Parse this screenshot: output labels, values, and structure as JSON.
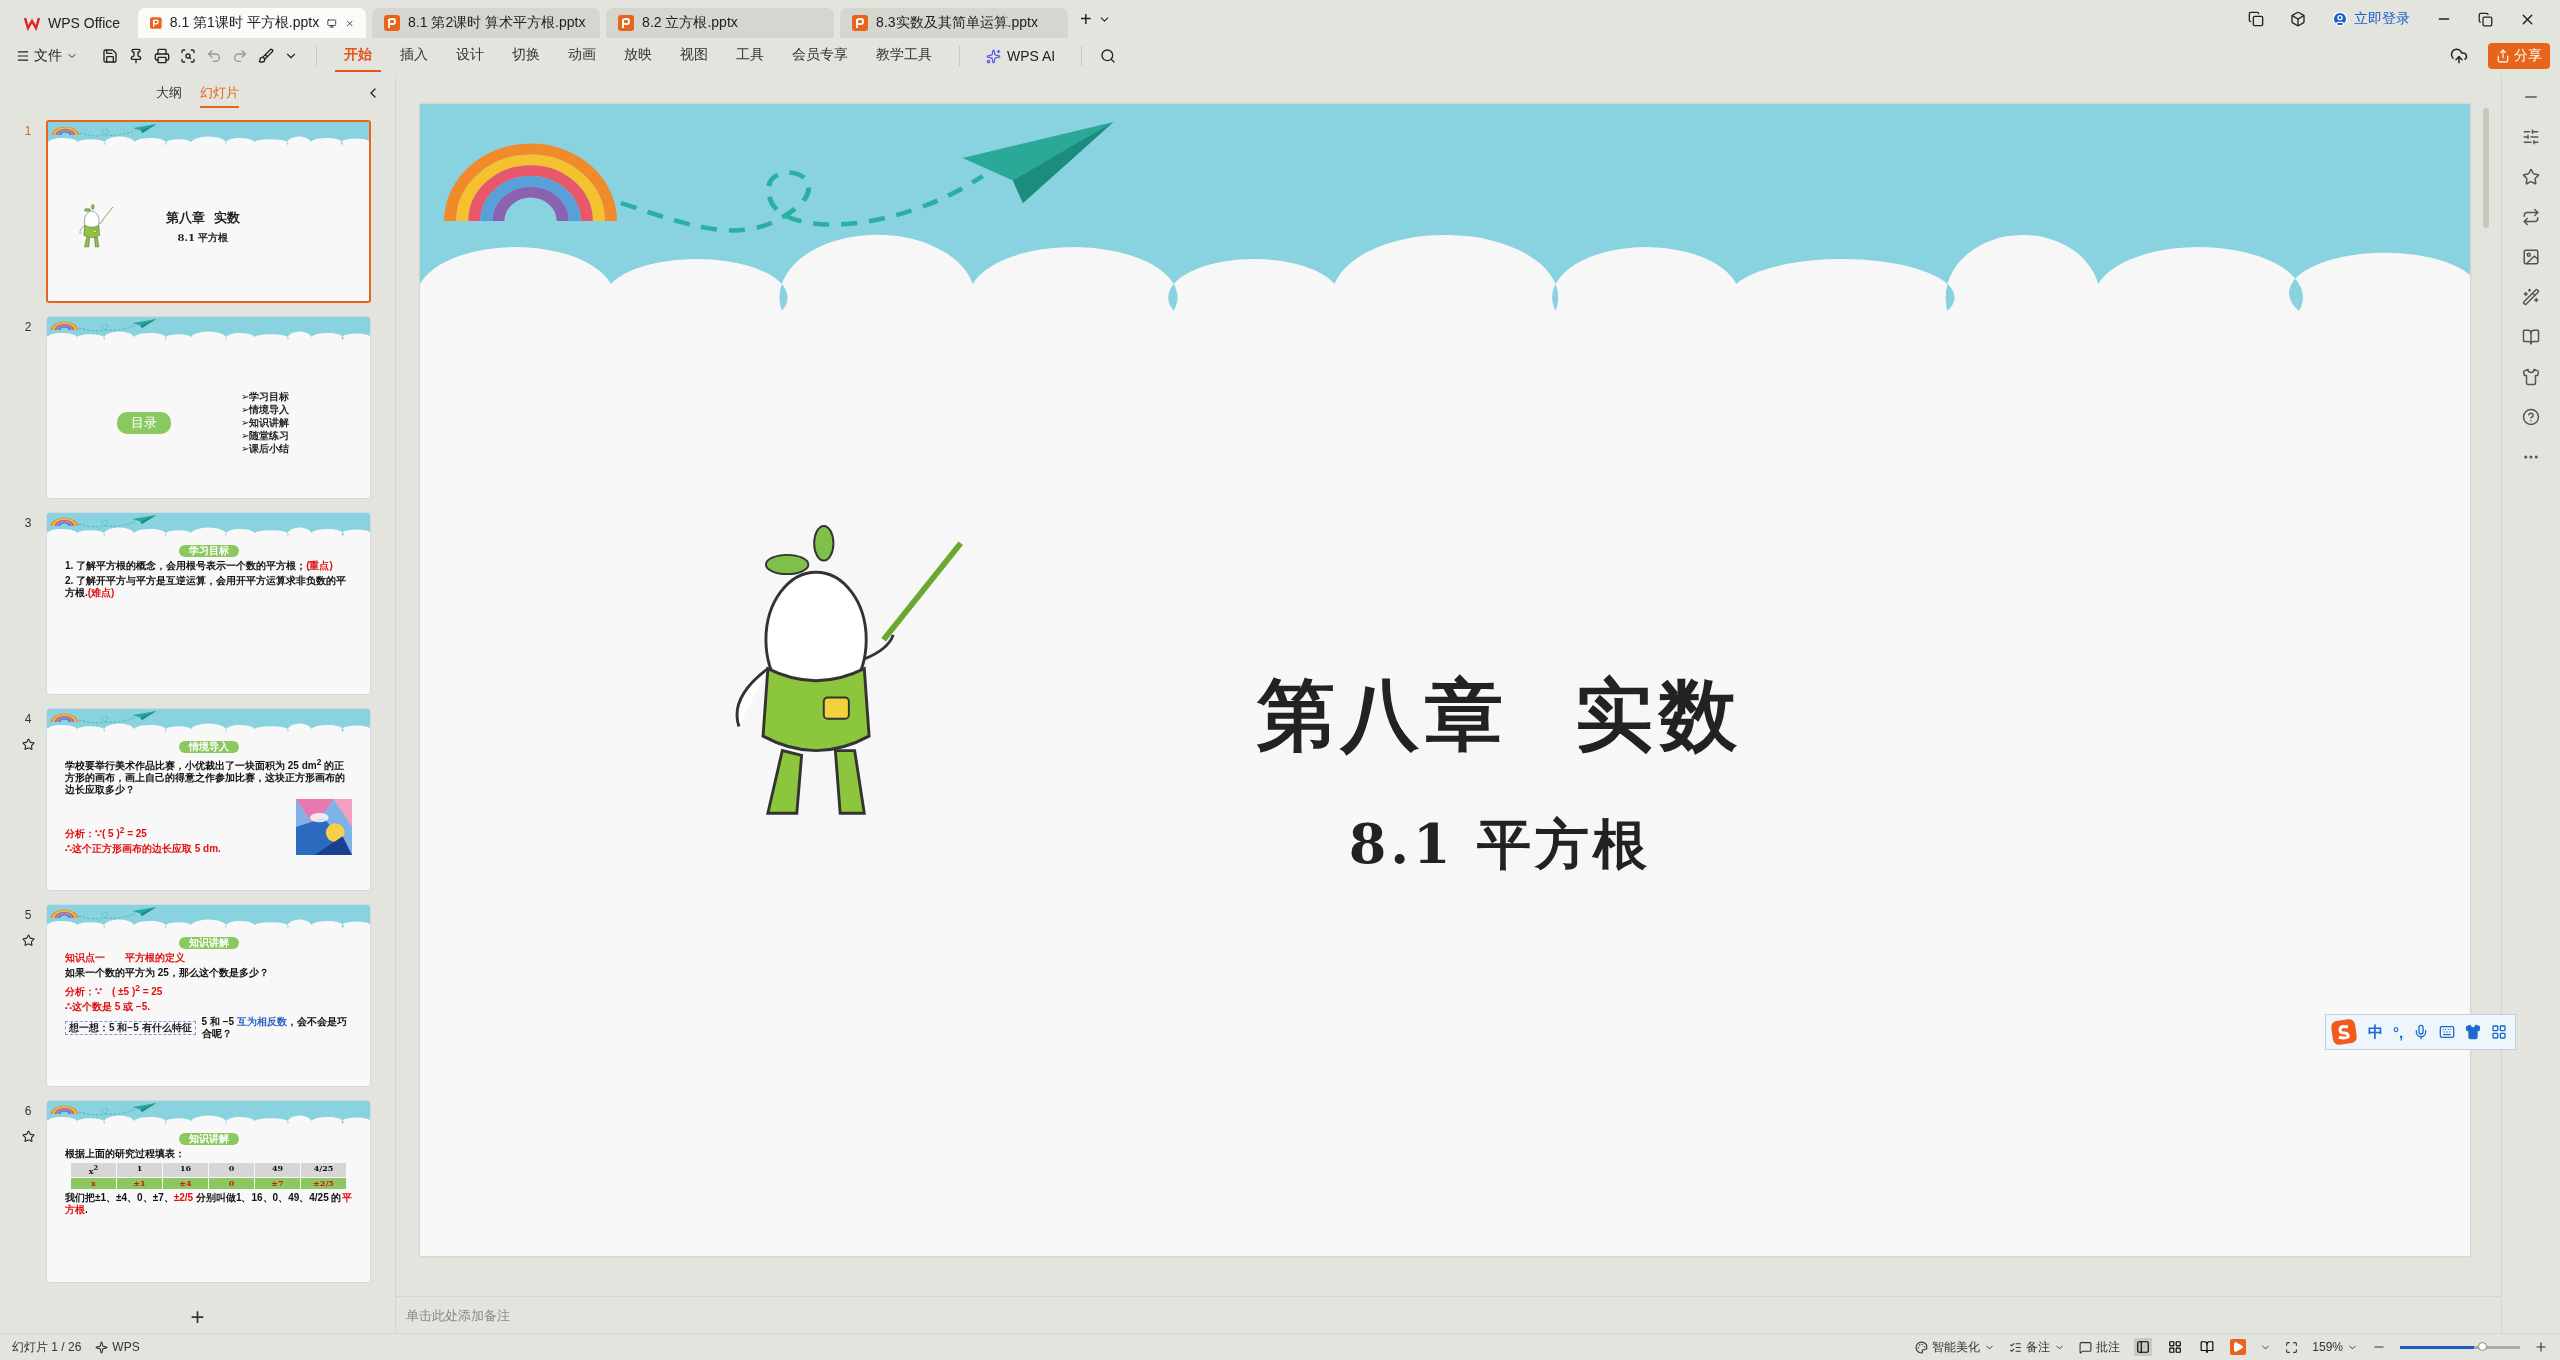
{
  "tabs": [
    {
      "label": "WPS Office",
      "kind": "home",
      "selected": false
    },
    {
      "label": "8.1 第1课时 平方根.pptx",
      "kind": "doc",
      "selected": true
    },
    {
      "label": "8.1 第2课时 算术平方根.pptx",
      "kind": "doc",
      "selected": false
    },
    {
      "label": "8.2 立方根.pptx",
      "kind": "doc",
      "selected": false
    },
    {
      "label": "8.3实数及其简单运算.pptx",
      "kind": "doc",
      "selected": false
    }
  ],
  "new_tab": "+",
  "account": "立即登录",
  "file_menu": "文件",
  "ribbon_tabs": [
    {
      "label": "开始",
      "selected": true
    },
    {
      "label": "插入",
      "selected": false
    },
    {
      "label": "设计",
      "selected": false
    },
    {
      "label": "切换",
      "selected": false
    },
    {
      "label": "动画",
      "selected": false
    },
    {
      "label": "放映",
      "selected": false
    },
    {
      "label": "视图",
      "selected": false
    },
    {
      "label": "工具",
      "selected": false
    },
    {
      "label": "会员专享",
      "selected": false
    },
    {
      "label": "教学工具",
      "selected": false
    }
  ],
  "ai_button": "WPS AI",
  "share": "分享",
  "panel_tabs": [
    {
      "label": "大纲",
      "selected": false
    },
    {
      "label": "幻灯片",
      "selected": true
    }
  ],
  "thumbnails": [
    {
      "number": "1",
      "selected": true,
      "marked": false,
      "kind": "title",
      "title": "第八章  实数",
      "subtitle": "8.1 平方根"
    },
    {
      "number": "2",
      "selected": false,
      "marked": false,
      "kind": "toc",
      "badge": "目录",
      "items": [
        "➢学习目标",
        "➢情境导入",
        "➢知识讲解",
        "➢随堂练习",
        "➢课后小结"
      ]
    },
    {
      "number": "3",
      "selected": false,
      "marked": false,
      "kind": "text",
      "badge": "学习目标",
      "lines": [
        [
          {
            "text": "1. 了解平方根的概念，会用根号表示一个数的平方根；"
          },
          {
            "text": "(重点)",
            "color": "#e01010"
          }
        ],
        [
          {
            "text": "2. 了解开平方与平方是互逆运算，会用开平方运算求非负数的平方根."
          },
          {
            "text": "(难点)",
            "color": "#e01010"
          }
        ]
      ]
    },
    {
      "number": "4",
      "selected": false,
      "marked": true,
      "kind": "illustrated",
      "badge": "情境导入",
      "lines": [
        [
          {
            "text": "学校要举行美术作品比赛，小优裁出了一块面积为 25 dm$^{2}$ 的正方形的画布，画上自己的得意之作参加比赛，这块正方形画布的边长应取多少？"
          }
        ],
        [
          {
            "text": "分析：∵( 5 )$^{2}$ = 25",
            "color": "#e01010"
          }
        ],
        [
          {
            "text": "∴这个正方形画布的边长应取 5 dm.",
            "color": "#e01010"
          }
        ]
      ]
    },
    {
      "number": "5",
      "selected": false,
      "marked": true,
      "kind": "text",
      "badge": "知识讲解",
      "lines": [
        [
          {
            "text": "知识点一　　平方根的定义",
            "color": "#e01010"
          }
        ],
        [
          {
            "text": "如果一个数的平方为 25，那么这个数是多少？"
          }
        ],
        [
          {
            "text": "分析：∵　( ±5 )$^{2}$ = 25",
            "color": "#e01010"
          }
        ],
        [
          {
            "text": "∴这个数是 5 或 −5.",
            "color": "#e01010"
          }
        ],
        [
          {
            "text": "5 和 −5 "
          },
          {
            "text": "互为相反数",
            "color": "#2a62c8"
          },
          {
            "text": "，会不会是巧合呢？"
          }
        ]
      ],
      "callout": "想一想：5 和−5 有什么特征"
    },
    {
      "number": "6",
      "selected": false,
      "marked": true,
      "kind": "table",
      "badge": "知识讲解",
      "intro": "根据上面的研究过程填表：",
      "table": [
        [
          "x$^{2}$",
          "1",
          "16",
          "0",
          "49",
          "4/25"
        ],
        [
          "x",
          "±1",
          "±4",
          "0",
          "±7",
          "±2/5"
        ]
      ],
      "lines": [
        [
          {
            "text": "我们把±1、±4、0、±7、"
          },
          {
            "text": "±2/5",
            "color": "#e01010"
          },
          {
            "text": " 分别叫做1、16、0、49、4/25 的"
          },
          {
            "text": "平方根",
            "color": "#e01010"
          },
          {
            "text": "."
          }
        ]
      ]
    }
  ],
  "add_slide": "+",
  "slide": {
    "title": "第八章  实数",
    "subtitle": "8.1 平方根"
  },
  "notes": {
    "placeholder": "单击此处添加备注"
  },
  "ime": [
    "中",
    "°,"
  ],
  "status": {
    "counter": "幻灯片 1 / 26",
    "brand": "WPS",
    "beautify": "智能美化",
    "notes": "备注",
    "comments": "批注",
    "zoom": "159%"
  },
  "views": [
    {
      "kind": "normal",
      "selected": true
    },
    {
      "kind": "sorter",
      "selected": false
    },
    {
      "kind": "reading",
      "selected": false
    }
  ],
  "zoom_slider": {
    "level": 0.62
  }
}
